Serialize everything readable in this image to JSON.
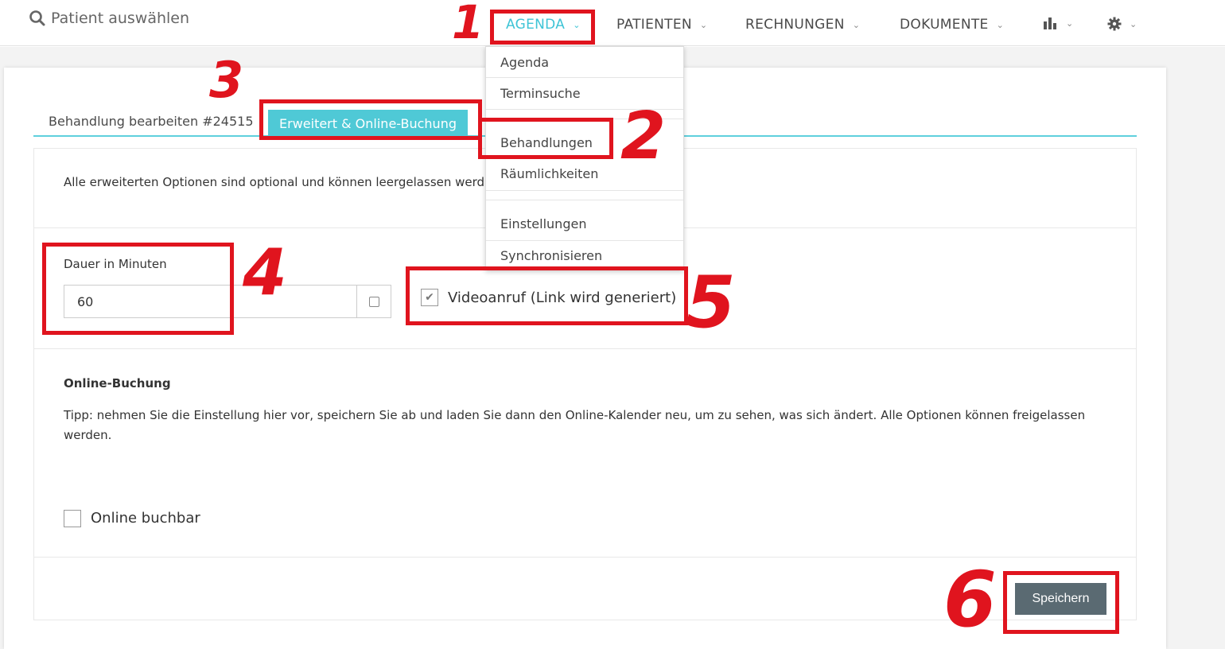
{
  "search": {
    "placeholder": "Patient auswählen",
    "icon": "search-icon"
  },
  "nav": {
    "agenda": "AGENDA",
    "patienten": "PATIENTEN",
    "rechnungen": "RECHNUNGEN",
    "dokumente": "DOKUMENTE",
    "stats_icon": "bar-chart-icon",
    "settings_icon": "gear-icon",
    "accent": "#3ec4d6"
  },
  "dropdown": {
    "items": [
      "Agenda",
      "Terminsuche",
      "Behandlungen",
      "Räumlichkeiten",
      "Einstellungen",
      "Synchronisieren"
    ]
  },
  "tabs": {
    "edit": "Behandlung bearbeiten #24515",
    "extended": "Erweitert & Online-Buchung"
  },
  "form": {
    "info": "Alle erweiterten Optionen sind optional und können leergelassen werd",
    "duration_label": "Dauer in Minuten",
    "duration_value": "60",
    "video_label": "Videoanruf (Link wird generiert)",
    "video_checked": true,
    "online_title": "Online-Buchung",
    "tip": "Tipp: nehmen Sie die Einstellung hier vor, speichern Sie ab und laden Sie dann den Online-Kalender neu, um zu sehen, was sich ändert. Alle Optionen können freigelassen werden.",
    "online_label": "Online buchbar",
    "online_checked": false,
    "save": "Speichern"
  },
  "annotations": [
    "1",
    "2",
    "3",
    "4",
    "5",
    "6"
  ],
  "colors": {
    "annotation_red": "#e0141e",
    "tab_active": "#4fc9d6",
    "button": "#5a6a72"
  }
}
